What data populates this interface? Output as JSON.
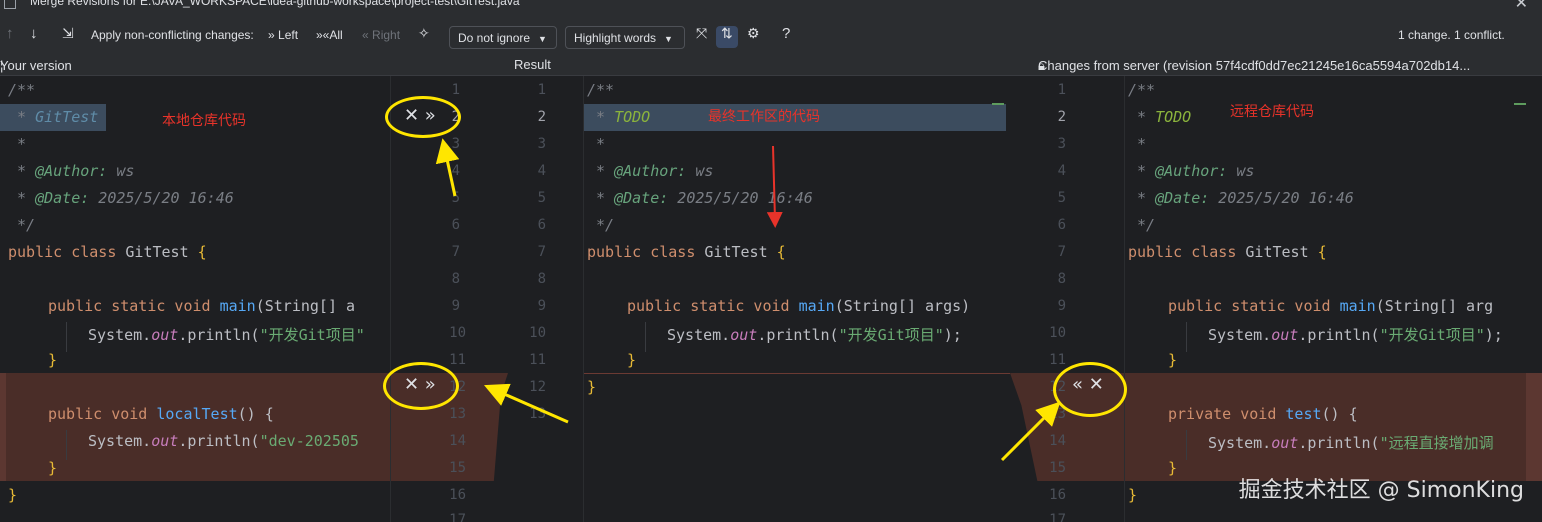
{
  "window": {
    "title": "Merge Revisions for E:\\JAVA_WORKSPACE\\idea-github-workspace\\project-test\\GitTest.java"
  },
  "toolbar": {
    "apply_label": "Apply non-conflicting changes:",
    "left_label": "Left",
    "all_label": "All",
    "right_label": "Right",
    "whitespace_select": "Do not ignore",
    "highlight_select": "Highlight words",
    "help_label": "?",
    "status": "1 change. 1 conflict."
  },
  "headers": {
    "left": "Your version",
    "center": "Result",
    "right": "Changes from server (revision 57f4cdf0dd7ec21245e16ca5594a702db14..."
  },
  "annotations": {
    "left": "本地仓库代码",
    "center": "最终工作区的代码",
    "right": "远程仓库代码"
  },
  "controls": {
    "left_top": "✕ »",
    "left_bottom": "✕ »",
    "right_bottom": "« ✕"
  },
  "line_numbers": {
    "left": [
      "1",
      "2",
      "3",
      "4",
      "5",
      "6",
      "7",
      "8",
      "9",
      "10",
      "11",
      "12",
      "13",
      "14",
      "15",
      "16",
      "17"
    ],
    "center": [
      "1",
      "2",
      "3",
      "4",
      "5",
      "6",
      "7",
      "8",
      "9",
      "10",
      "11",
      "12",
      "13"
    ],
    "right": [
      "1",
      "2",
      "3",
      "4",
      "5",
      "6",
      "7",
      "8",
      "9",
      "10",
      "11",
      "12",
      "13",
      "14",
      "15",
      "16",
      "17"
    ]
  },
  "left_code": {
    "l1": "/**",
    "l2_star": " * ",
    "l2_word": "GitTest",
    "l3": " *",
    "l4_star": " * ",
    "l4_tag": "@Author:",
    "l4_rest": " ws",
    "l5_star": " * ",
    "l5_tag": "@Date:",
    "l5_rest": " 2025/5/20 16:46",
    "l6": " */",
    "l7_kw": "public class ",
    "l7_name": "GitTest ",
    "l7_brace": "{",
    "l9_kw": "public static void ",
    "l9_fn": "main",
    "l9_rest": "(String[] a",
    "l10_pre": "System.",
    "l10_out": "out",
    "l10_call": ".println(",
    "l10_str": "\"开发Git项目\"",
    "l11": "}",
    "l13_kw": "public void ",
    "l13_fn": "localTest",
    "l13_rest": "() {",
    "l14_pre": "System.",
    "l14_out": "out",
    "l14_call": ".println(",
    "l14_str": "\"dev-202505",
    "l15": "}",
    "l16": "}"
  },
  "center_code": {
    "l1": "/**",
    "l2_star": " * ",
    "l2_word": "TODO",
    "l3": " *",
    "l4_star": " * ",
    "l4_tag": "@Author:",
    "l4_rest": " ws",
    "l5_star": " * ",
    "l5_tag": "@Date:",
    "l5_rest": " 2025/5/20 16:46",
    "l6": " */",
    "l7_kw": "public class ",
    "l7_name": "GitTest ",
    "l7_brace": "{",
    "l9_kw": "public static void ",
    "l9_fn": "main",
    "l9_rest": "(String[] args)",
    "l10_pre": "System.",
    "l10_out": "out",
    "l10_call": ".println(",
    "l10_str": "\"开发Git项目\"",
    "l10_end": ");",
    "l11": "}",
    "l12": "}"
  },
  "right_code": {
    "l1": "/**",
    "l2_star": " * ",
    "l2_word": "TODO",
    "l3": " *",
    "l4_star": " * ",
    "l4_tag": "@Author:",
    "l4_rest": " ws",
    "l5_star": " * ",
    "l5_tag": "@Date:",
    "l5_rest": " 2025/5/20 16:46",
    "l6": " */",
    "l7_kw": "public class ",
    "l7_name": "GitTest ",
    "l7_brace": "{",
    "l9_kw": "public static void ",
    "l9_fn": "main",
    "l9_rest": "(String[] arg",
    "l10_pre": "System.",
    "l10_out": "out",
    "l10_call": ".println(",
    "l10_str": "\"开发Git项目\"",
    "l10_end": ");",
    "l11": "}",
    "l13_kw": "private void ",
    "l13_fn": "test",
    "l13_rest": "() {",
    "l14_pre": "System.",
    "l14_out": "out",
    "l14_call": ".println(",
    "l14_str": "\"远程直接增加调",
    "l15": "}",
    "l16": "}"
  },
  "watermark": "掘金技术社区 @ SimonKing",
  "colors": {
    "background": "#1e1f22",
    "toolbar": "#2b2d30",
    "conflict": "#4a2d28",
    "highlight_line": "#3c4c5e",
    "annotation_red": "#e8332a",
    "marker_yellow": "#ffe600"
  }
}
